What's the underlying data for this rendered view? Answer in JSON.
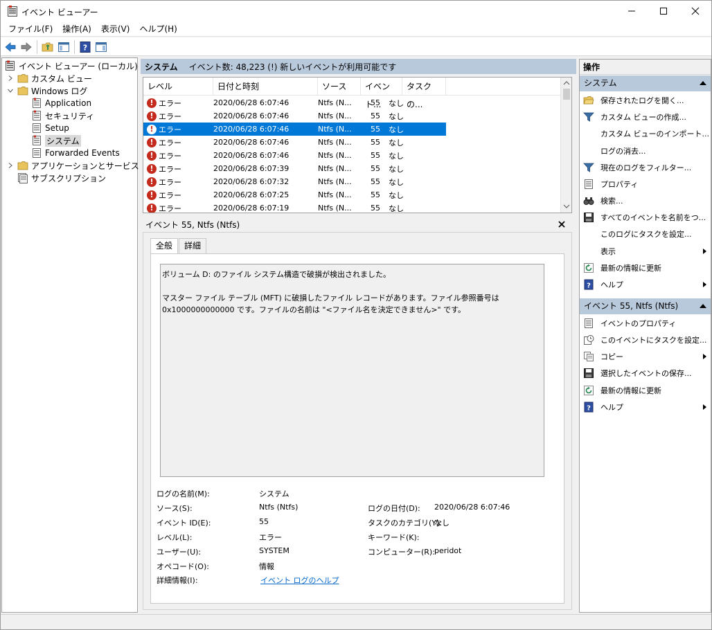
{
  "window": {
    "title": "イベント ビューアー"
  },
  "menu": [
    "ファイル(F)",
    "操作(A)",
    "表示(V)",
    "ヘルプ(H)"
  ],
  "tree": {
    "root": "イベント ビューアー (ローカル)",
    "custom_views": "カスタム ビュー",
    "windows_logs": "Windows ログ",
    "application": "Application",
    "security": "セキュリティ",
    "setup": "Setup",
    "system": "システム",
    "forwarded": "Forwarded Events",
    "apps_services": "アプリケーションとサービス ログ",
    "subscriptions": "サブスクリプション"
  },
  "center": {
    "header_name": "システム",
    "header_info": "イベント数: 48,223 (!) 新しいイベントが利用可能です",
    "columns": [
      "レベル",
      "日付と時刻",
      "ソース",
      "イベント...",
      "タスクの..."
    ],
    "rows": [
      {
        "level": "エラー",
        "datetime": "2020/06/28 6:07:46",
        "source": "Ntfs (N...",
        "id": "55",
        "task": "なし"
      },
      {
        "level": "エラー",
        "datetime": "2020/06/28 6:07:46",
        "source": "Ntfs (N...",
        "id": "55",
        "task": "なし"
      },
      {
        "level": "エラー",
        "datetime": "2020/06/28 6:07:46",
        "source": "Ntfs (N...",
        "id": "55",
        "task": "なし"
      },
      {
        "level": "エラー",
        "datetime": "2020/06/28 6:07:46",
        "source": "Ntfs (N...",
        "id": "55",
        "task": "なし"
      },
      {
        "level": "エラー",
        "datetime": "2020/06/28 6:07:46",
        "source": "Ntfs (N...",
        "id": "55",
        "task": "なし"
      },
      {
        "level": "エラー",
        "datetime": "2020/06/28 6:07:39",
        "source": "Ntfs (N...",
        "id": "55",
        "task": "なし"
      },
      {
        "level": "エラー",
        "datetime": "2020/06/28 6:07:32",
        "source": "Ntfs (N...",
        "id": "55",
        "task": "なし"
      },
      {
        "level": "エラー",
        "datetime": "2020/06/28 6:07:25",
        "source": "Ntfs (N...",
        "id": "55",
        "task": "なし"
      },
      {
        "level": "エラー",
        "datetime": "2020/06/28 6:07:19",
        "source": "Ntfs (N...",
        "id": "55",
        "task": "なし"
      }
    ],
    "selected_row": 2
  },
  "detail": {
    "title": "イベント 55, Ntfs (Ntfs)",
    "tab_general": "全般",
    "tab_details": "詳細",
    "desc1": "ボリューム D: のファイル システム構造で破損が検出されました。",
    "desc2": "マスター ファイル テーブル (MFT) に破損したファイル レコードがあります。ファイル参照番号は 0x1000000000000 です。ファイルの名前は \"<ファイル名を決定できません>\" です。",
    "props": {
      "log_name_label": "ログの名前(M):",
      "log_name": "システム",
      "source_label": "ソース(S):",
      "source": "Ntfs (Ntfs)",
      "logged_label": "ログの日付(D):",
      "logged": "2020/06/28 6:07:46",
      "event_id_label": "イベント ID(E):",
      "event_id": "55",
      "category_label": "タスクのカテゴリ(Y):",
      "category": "なし",
      "level_label": "レベル(L):",
      "level": "エラー",
      "keywords_label": "キーワード(K):",
      "user_label": "ユーザー(U):",
      "user": "SYSTEM",
      "computer_label": "コンピューター(R):",
      "computer": "peridot",
      "opcode_label": "オペコード(O):",
      "opcode": "情報",
      "more_info_label": "詳細情報(I):",
      "more_info": "イベント ログのヘルプ"
    }
  },
  "actions": {
    "title": "操作",
    "section1": "システム",
    "items1": [
      "保存されたログを開く...",
      "カスタム ビューの作成...",
      "カスタム ビューのインポート...",
      "ログの消去...",
      "現在のログをフィルター...",
      "プロパティ",
      "検索...",
      "すべてのイベントを名前をつ...",
      "このログにタスクを設定...",
      "表示",
      "最新の情報に更新",
      "ヘルプ"
    ],
    "section2": "イベント 55, Ntfs (Ntfs)",
    "items2": [
      "イベントのプロパティ",
      "このイベントにタスクを設定...",
      "コピー",
      "選択したイベントの保存...",
      "最新の情報に更新",
      "ヘルプ"
    ]
  },
  "colors": {
    "selection": "#0078d7",
    "section_header": "#b9c9dc",
    "error": "#c42b1c",
    "link": "#0066cc"
  }
}
